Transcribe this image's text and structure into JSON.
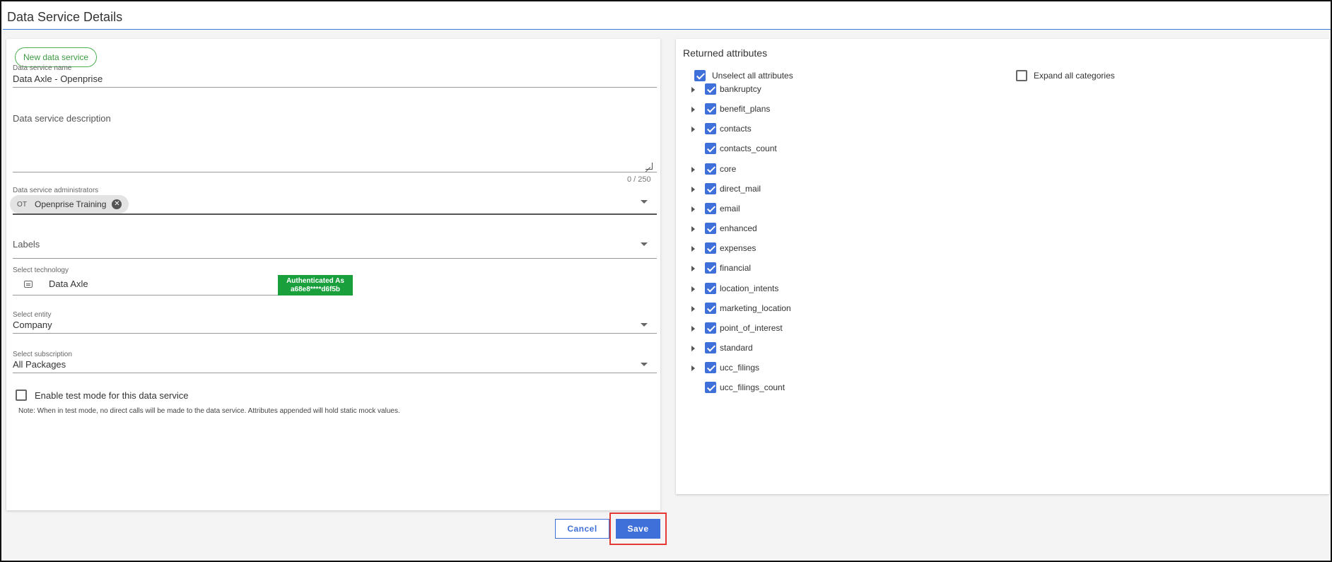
{
  "page": {
    "title": "Data Service Details"
  },
  "left": {
    "new_service_label": "New data service",
    "name_label": "Data service name",
    "name_value": "Data Axle - Openprise",
    "description_placeholder": "Data service description",
    "description_counter": "0 / 250",
    "admins_label": "Data service administrators",
    "admin_chip": {
      "initials": "OT",
      "name": "Openprise Training"
    },
    "labels_placeholder": "Labels",
    "technology_label": "Select technology",
    "technology_value": "Data Axle",
    "auth_line1": "Authenticated As",
    "auth_line2": "a68e8****d6f5b",
    "entity_label": "Select entity",
    "entity_value": "Company",
    "subscription_label": "Select subscription",
    "subscription_value": "All Packages",
    "test_mode_label": "Enable test mode for this data service",
    "test_mode_checked": false,
    "note": "Note: When in test mode, no direct calls will be made to the data service. Attributes appended will hold static mock values."
  },
  "right": {
    "title": "Returned attributes",
    "unselect_all_label": "Unselect all attributes",
    "unselect_all_checked": true,
    "expand_all_label": "Expand all categories",
    "expand_all_checked": false,
    "attributes": [
      {
        "label": "bankruptcy",
        "expandable": true,
        "checked": true
      },
      {
        "label": "benefit_plans",
        "expandable": true,
        "checked": true
      },
      {
        "label": "contacts",
        "expandable": true,
        "checked": true
      },
      {
        "label": "contacts_count",
        "expandable": false,
        "checked": true
      },
      {
        "label": "core",
        "expandable": true,
        "checked": true
      },
      {
        "label": "direct_mail",
        "expandable": true,
        "checked": true
      },
      {
        "label": "email",
        "expandable": true,
        "checked": true
      },
      {
        "label": "enhanced",
        "expandable": true,
        "checked": true
      },
      {
        "label": "expenses",
        "expandable": true,
        "checked": true
      },
      {
        "label": "financial",
        "expandable": true,
        "checked": true
      },
      {
        "label": "location_intents",
        "expandable": true,
        "checked": true
      },
      {
        "label": "marketing_location",
        "expandable": true,
        "checked": true
      },
      {
        "label": "point_of_interest",
        "expandable": true,
        "checked": true
      },
      {
        "label": "standard",
        "expandable": true,
        "checked": true
      },
      {
        "label": "ucc_filings",
        "expandable": true,
        "checked": true
      },
      {
        "label": "ucc_filings_count",
        "expandable": false,
        "checked": true
      }
    ]
  },
  "footer": {
    "cancel_label": "Cancel",
    "save_label": "Save"
  },
  "colors": {
    "accent": "#3f6fd8",
    "auth_badge": "#19a03c",
    "highlight": "#e53935",
    "new_service_border": "#4caf50"
  }
}
